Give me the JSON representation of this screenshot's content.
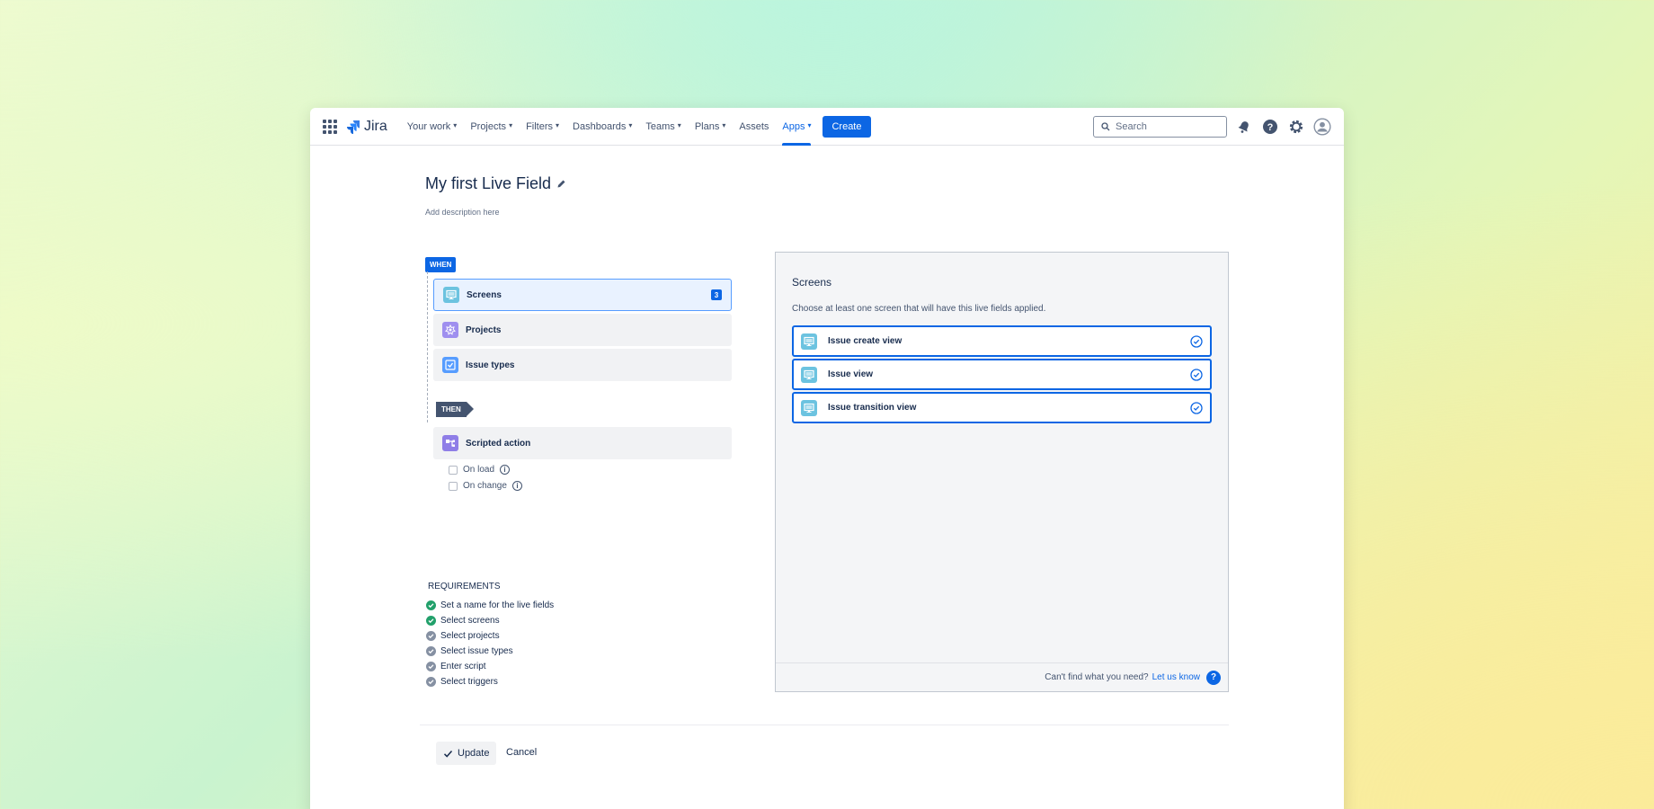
{
  "nav": {
    "logo_text": "Jira",
    "items": [
      {
        "label": "Your work",
        "chevron": true
      },
      {
        "label": "Projects",
        "chevron": true
      },
      {
        "label": "Filters",
        "chevron": true
      },
      {
        "label": "Dashboards",
        "chevron": true
      },
      {
        "label": "Teams",
        "chevron": true
      },
      {
        "label": "Plans",
        "chevron": true
      },
      {
        "label": "Assets",
        "chevron": false
      },
      {
        "label": "Apps",
        "chevron": true,
        "active": true
      }
    ],
    "create_label": "Create",
    "search_placeholder": "Search"
  },
  "page": {
    "title": "My first Live Field",
    "description_placeholder": "Add description here"
  },
  "when": {
    "badge": "WHEN",
    "cards": [
      {
        "label": "Screens",
        "icon": "monitor-icon",
        "count": "3",
        "selected": true
      },
      {
        "label": "Projects",
        "icon": "project-icon"
      },
      {
        "label": "Issue types",
        "icon": "issue-type-icon"
      }
    ]
  },
  "then": {
    "badge": "THEN",
    "action_label": "Scripted action",
    "triggers": [
      {
        "label": "On load",
        "checked": false
      },
      {
        "label": "On change",
        "checked": false
      }
    ]
  },
  "requirements": {
    "title": "REQUIREMENTS",
    "items": [
      {
        "label": "Set a name for the live fields",
        "done": true
      },
      {
        "label": "Select screens",
        "done": true
      },
      {
        "label": "Select projects",
        "done": false
      },
      {
        "label": "Select issue types",
        "done": false
      },
      {
        "label": "Enter script",
        "done": false
      },
      {
        "label": "Select triggers",
        "done": false
      }
    ]
  },
  "panel": {
    "title": "Screens",
    "subtitle": "Choose at least one screen that will have this live fields applied.",
    "options": [
      {
        "label": "Issue create view",
        "selected": true
      },
      {
        "label": "Issue view",
        "selected": true
      },
      {
        "label": "Issue transition view",
        "selected": true
      }
    ],
    "footer_text": "Can't find what you need?",
    "footer_link": "Let us know"
  },
  "actions": {
    "update_label": "Update",
    "cancel_label": "Cancel"
  },
  "colors": {
    "primary": "#0c66e4",
    "done": "#22a06b",
    "todo": "#8590a2"
  }
}
